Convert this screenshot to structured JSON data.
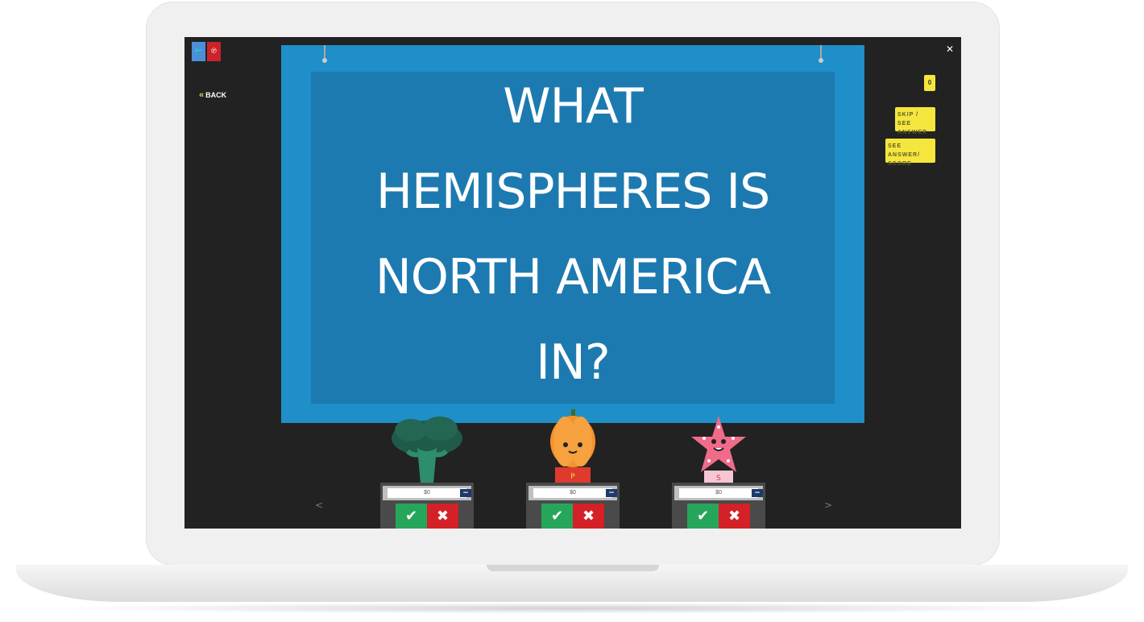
{
  "share": {
    "twitter_icon": "twitter-icon",
    "pinterest_icon": "pinterest-icon",
    "twitter_glyph": "🐦",
    "pinterest_glyph": "℗"
  },
  "nav": {
    "back_chevron": "«",
    "back_label": "BACK",
    "fullscreen_glyph": "✕"
  },
  "board": {
    "question": "WHAT HEMISPHERES IS NORTH AMERICA IN?"
  },
  "controls": {
    "score_chip": "0",
    "skip_label": "SKIP / SEE ANSWER",
    "see_label": "SEE ANSWER/ SCORE",
    "prev_arrow": "<",
    "next_arrow": ">"
  },
  "players": [
    {
      "character": "broccoli",
      "score": "$0",
      "plus": "+",
      "minus": "−",
      "correct": "✔",
      "wrong": "✖"
    },
    {
      "character": "pumpkin",
      "score": "$0",
      "plus": "+",
      "minus": "−",
      "correct": "✔",
      "wrong": "✖"
    },
    {
      "character": "starfish",
      "score": "$0",
      "plus": "+",
      "minus": "−",
      "correct": "✔",
      "wrong": "✖"
    }
  ],
  "colors": {
    "board": "#1e8fc8",
    "board_inner": "#1d7ab0",
    "accent_yellow": "#f5e63d",
    "correct": "#26a65b",
    "wrong": "#d42027"
  }
}
